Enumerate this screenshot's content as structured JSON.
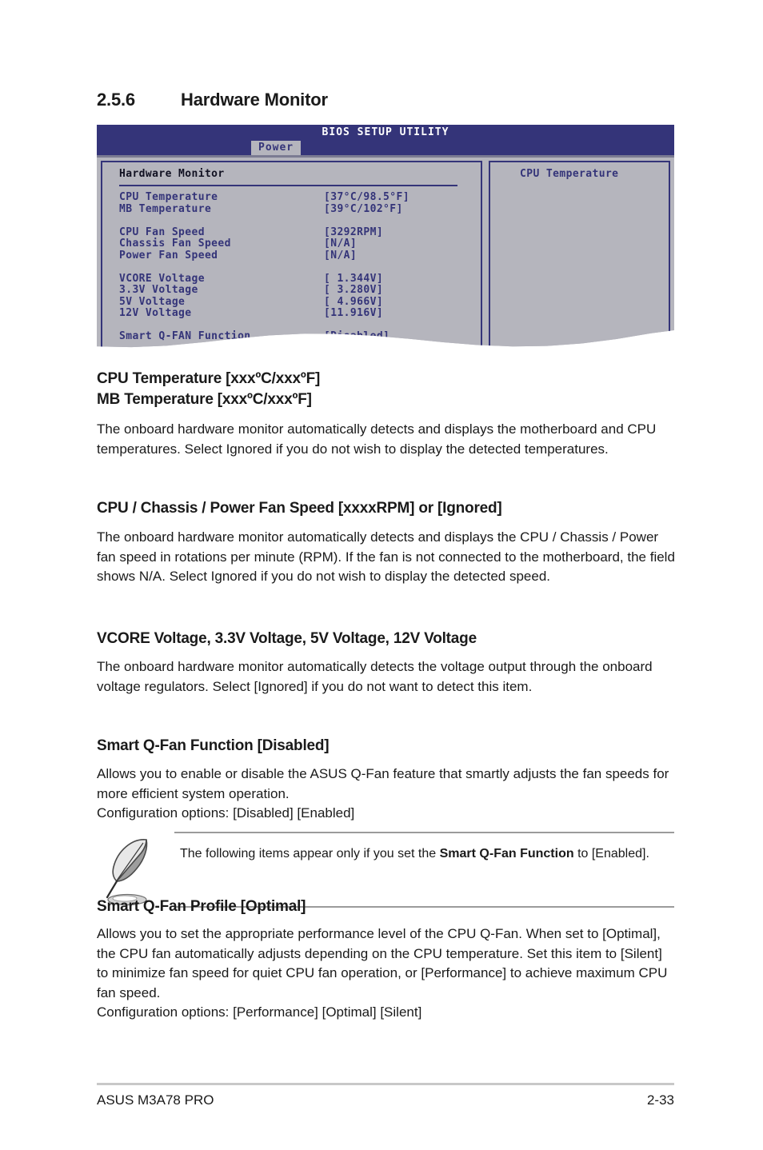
{
  "section": {
    "number": "2.5.6",
    "title": "Hardware Monitor"
  },
  "bios": {
    "title": "BIOS SETUP UTILITY",
    "active_tab": "Power",
    "panel_title": "Hardware Monitor",
    "help_panel": {
      "title": "CPU Temperature"
    },
    "colors": {
      "header_bg": "#343479",
      "panel_bg": "#b5b5bd",
      "text_blue": "#343479",
      "title_text": "#ffffff"
    },
    "items": [
      {
        "label": "CPU Temperature",
        "value": "[37°C/98.5°F]"
      },
      {
        "label": "MB Temperature",
        "value": "[39°C/102°F]"
      },
      {
        "label": "",
        "value": ""
      },
      {
        "label": "CPU Fan Speed",
        "value": "[3292RPM]"
      },
      {
        "label": "Chassis Fan Speed",
        "value": "[N/A]"
      },
      {
        "label": "Power Fan Speed",
        "value": "[N/A]"
      },
      {
        "label": "",
        "value": ""
      },
      {
        "label": "VCORE Voltage",
        "value": "[ 1.344V]"
      },
      {
        "label": "3.3V Voltage",
        "value": "[ 3.280V]"
      },
      {
        "label": "5V Voltage",
        "value": "[ 4.966V]"
      },
      {
        "label": "12V Voltage",
        "value": "[11.916V]"
      },
      {
        "label": "",
        "value": ""
      },
      {
        "label": "Smart Q-FAN Function",
        "value": "[Disabled]"
      }
    ]
  },
  "sections": [
    {
      "heading_line1": "CPU Temperature [xxxºC/xxxºF]",
      "heading_line2": "MB Temperature [xxxºC/xxxºF]",
      "body": "The onboard hardware monitor automatically detects and displays the motherboard and CPU temperatures. Select Ignored if you do not wish to display the detected temperatures."
    },
    {
      "heading": "CPU / Chassis / Power Fan Speed [xxxxRPM] or [Ignored]",
      "body": "The onboard hardware monitor automatically detects and displays the CPU / Chassis / Power fan speed in rotations per minute (RPM). If the fan is not connected to the motherboard, the field shows N/A. Select Ignored if you do not wish to display the detected speed."
    },
    {
      "heading": "VCORE Voltage, 3.3V Voltage, 5V Voltage, 12V Voltage",
      "body": "The onboard hardware monitor automatically detects the voltage output through the onboard voltage regulators. Select [Ignored] if you do not want to detect this item."
    },
    {
      "heading": "Smart Q-Fan Function [Disabled]",
      "body": "Allows you to enable or disable the ASUS Q-Fan feature that smartly adjusts the fan speeds for more efficient system operation.\nConfiguration options: [Disabled] [Enabled]"
    },
    {
      "heading": "Smart Q-Fan Profile [Optimal]",
      "body": "Allows you to set the appropriate performance level of the CPU Q-Fan. When set to [Optimal], the CPU fan automatically adjusts depending on the CPU temperature. Set this item to [Silent] to minimize fan speed for quiet CPU fan operation, or [Performance] to achieve maximum CPU fan speed.\nConfiguration options: [Performance] [Optimal] [Silent]"
    }
  ],
  "note": {
    "icon": "quill-pen-icon",
    "text_before": "The following items appear only if you set the ",
    "text_bold": "Smart Q-Fan Function",
    "text_after": " to [Enabled]."
  },
  "footer": {
    "left": "ASUS M3A78 PRO",
    "right": "2-33"
  }
}
